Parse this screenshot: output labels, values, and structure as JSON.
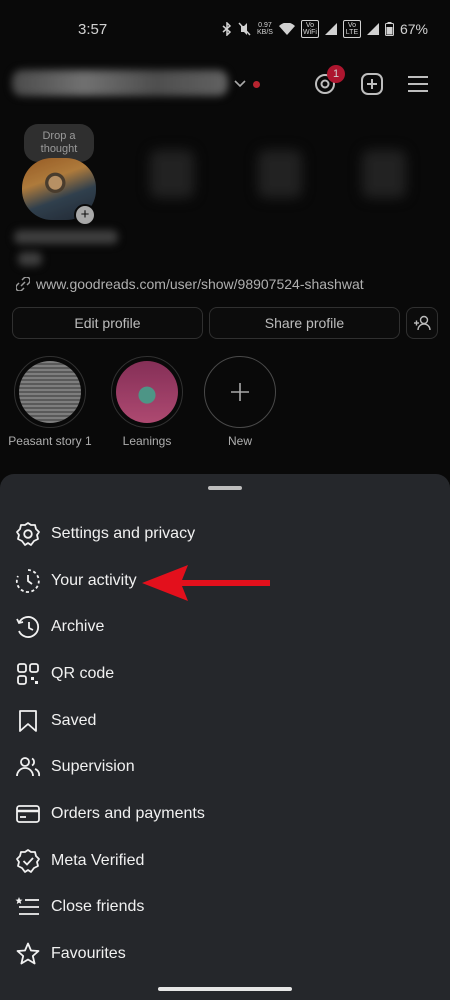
{
  "status_bar": {
    "time": "3:57",
    "speed_value": "0.97",
    "speed_unit": "KB/S",
    "wifi_tag": "Vo WiFi",
    "lte_tag": "Vo LTE",
    "battery": "67%"
  },
  "profile": {
    "notifications_badge": "1",
    "note_text": "Drop a thought",
    "link": "www.goodreads.com/user/show/98907524-shashwat",
    "edit_profile_label": "Edit profile",
    "share_profile_label": "Share profile"
  },
  "highlights": [
    {
      "label": "Peasant story 1"
    },
    {
      "label": "Leanings"
    },
    {
      "label": "New"
    }
  ],
  "menu": {
    "items": [
      {
        "label": "Settings and privacy",
        "icon": "gear-icon"
      },
      {
        "label": "Your activity",
        "icon": "activity-icon"
      },
      {
        "label": "Archive",
        "icon": "archive-icon"
      },
      {
        "label": "QR code",
        "icon": "qr-code-icon"
      },
      {
        "label": "Saved",
        "icon": "bookmark-icon"
      },
      {
        "label": "Supervision",
        "icon": "supervision-icon"
      },
      {
        "label": "Orders and payments",
        "icon": "card-icon"
      },
      {
        "label": "Meta Verified",
        "icon": "verified-badge-icon"
      },
      {
        "label": "Close friends",
        "icon": "close-friends-icon"
      },
      {
        "label": "Favourites",
        "icon": "star-icon"
      }
    ]
  },
  "colors": {
    "background": "#0b0b0b",
    "sheet": "#25272b",
    "badge": "#d41b3a",
    "annotation_arrow": "#e3101c"
  }
}
